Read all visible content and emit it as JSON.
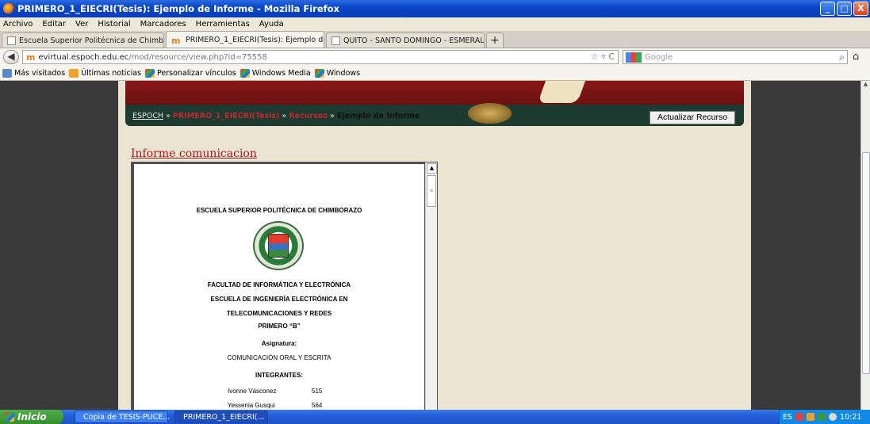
{
  "window": {
    "title": "PRIMERO_1_EIECRI(Tesis): Ejemplo de Informe - Mozilla Firefox",
    "controls": [
      "_",
      "□",
      "X"
    ]
  },
  "menu": [
    "Archivo",
    "Editar",
    "Ver",
    "Historial",
    "Marcadores",
    "Herramientas",
    "Ayuda"
  ],
  "tabs": [
    {
      "label": "Escuela Superior Politécnica de Chimborazo",
      "active": false
    },
    {
      "label": "PRIMERO_1_EIECRI(Tesis): Ejemplo de I...",
      "active": true
    },
    {
      "label": "QUITO - SANTO DOMINGO - ESMERALDA...",
      "active": false
    }
  ],
  "newtab_label": "+",
  "nav": {
    "url_domain": "evirtual.espoch.edu.ec",
    "url_path": "/mod/resource/view.php?id=75558",
    "url_icons": "☆ ▿ C",
    "search_placeholder": "Google"
  },
  "bookmarks": [
    "Más visitados",
    "Últimas noticias",
    "Personalizar vínculos",
    "Windows Media",
    "Windows"
  ],
  "breadcrumb": {
    "root": "ESPOCH",
    "course": "PRIMERO_1_EIECRI(Tesis)",
    "section": "Recursos",
    "current": "Ejemplo de Informe",
    "sep": "»"
  },
  "update_button": "Actualizar Recurso",
  "resource_title": "Informe comunicacion",
  "document": {
    "institution": "ESCUELA SUPERIOR POLITÉCNICA DE CHIMBORAZO",
    "faculty": "FACULTAD DE INFORMÁTICA Y ELECTRÓNICA",
    "school_line1": "ESCUELA DE INGENIERÍA ELECTRÓNICA EN",
    "school_line2": "TELECOMUNICACIONES Y REDES",
    "level": "PRIMERO “B”",
    "subject_label": "Asignatura:",
    "subject": "COMUNICACIÓN ORAL Y ESCRITA",
    "members_label": "INTEGRANTES:",
    "members": [
      {
        "name": "Ivonne Vásconez",
        "code": "515"
      },
      {
        "name": "Yessenia Gusqui",
        "code": "564"
      }
    ]
  },
  "taskbar": {
    "start": "Inicio",
    "items": [
      {
        "label": "Copia de TESIS-PUCE...",
        "active": false
      },
      {
        "label": "PRIMERO_1_EIECRI(...",
        "active": true
      }
    ],
    "lang": "ES",
    "clock": "10:21"
  }
}
